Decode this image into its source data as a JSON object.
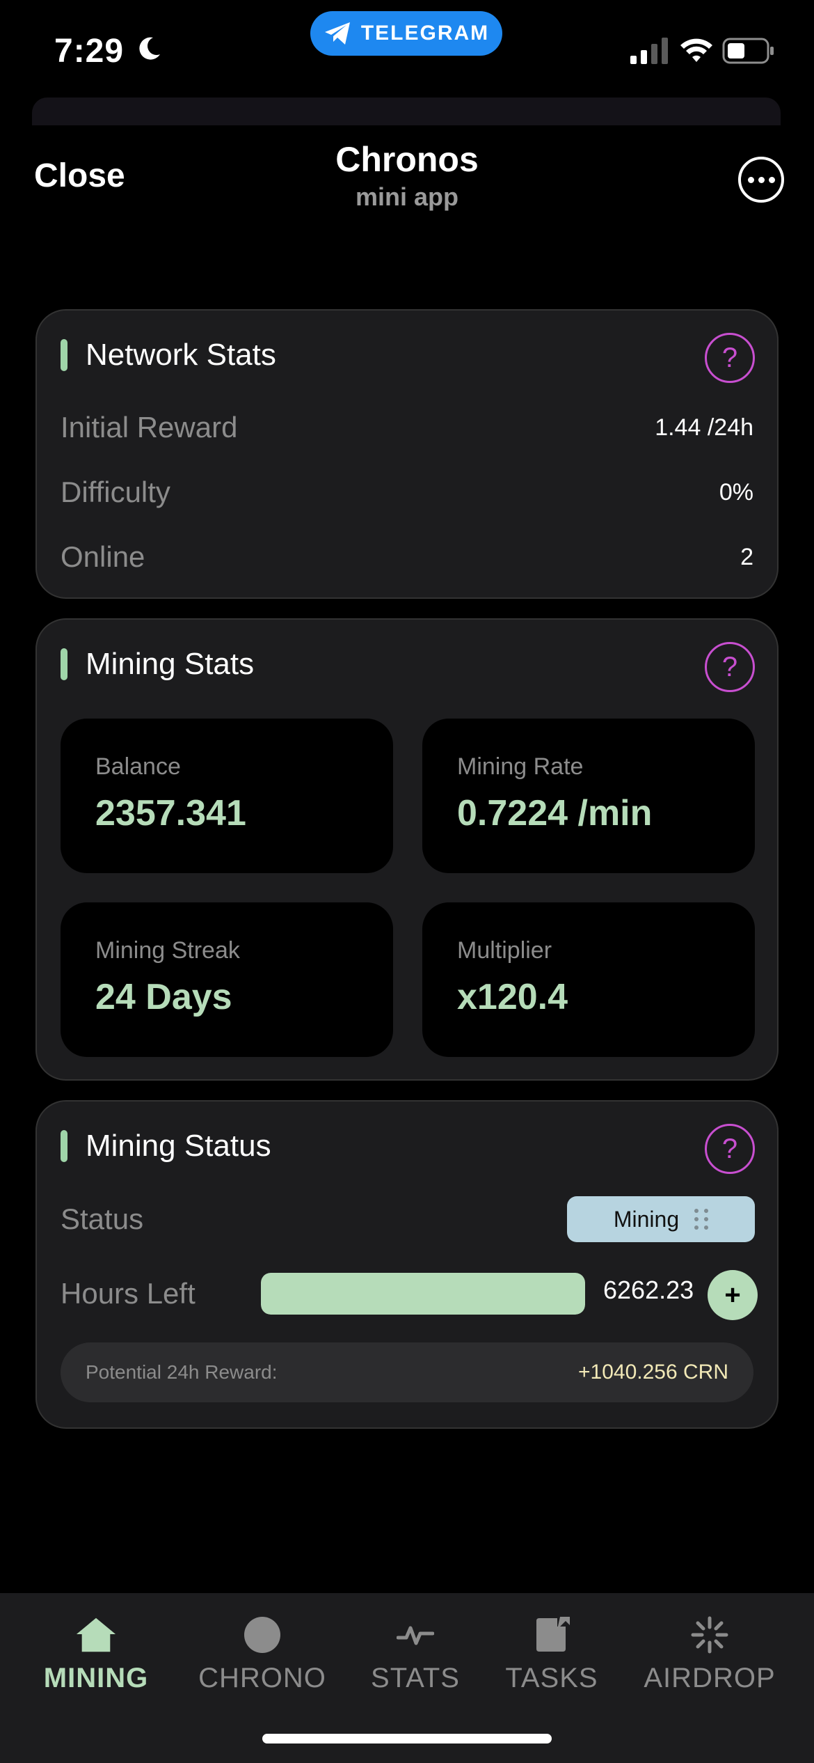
{
  "status_bar": {
    "time": "7:29",
    "telegram_label": "TELEGRAM"
  },
  "header": {
    "close_label": "Close",
    "title": "Chronos",
    "subtitle": "mini app"
  },
  "help_label": "?",
  "network_stats": {
    "title": "Network Stats",
    "rows": [
      {
        "label": "Initial Reward",
        "value": "1.44 /24h"
      },
      {
        "label": "Difficulty",
        "value": "0%"
      },
      {
        "label": "Online",
        "value": "2"
      }
    ]
  },
  "mining_stats": {
    "title": "Mining Stats",
    "tiles": [
      {
        "label": "Balance",
        "value": "2357.341"
      },
      {
        "label": "Mining Rate",
        "value": "0.7224 /min"
      },
      {
        "label": "Mining Streak",
        "value": "24 Days"
      },
      {
        "label": "Multiplier",
        "value": "x120.4"
      }
    ]
  },
  "mining_status": {
    "title": "Mining Status",
    "status_label": "Status",
    "status_value": "Mining",
    "hours_label": "Hours Left",
    "hours_value": "6262.23",
    "hours_progress": 1.0,
    "plus_label": "+",
    "reward_label": "Potential 24h Reward:",
    "reward_value": "+1040.256 CRN"
  },
  "nav": {
    "items": [
      {
        "label": "MINING",
        "icon": "home-icon",
        "active": true
      },
      {
        "label": "CHRONO",
        "icon": "circle-icon",
        "active": false
      },
      {
        "label": "STATS",
        "icon": "pulse-icon",
        "active": false
      },
      {
        "label": "TASKS",
        "icon": "task-icon",
        "active": false
      },
      {
        "label": "AIRDROP",
        "icon": "sparkle-icon",
        "active": false
      }
    ]
  },
  "colors": {
    "accent_green": "#b6dcb9",
    "help_purple": "#c84fd0",
    "status_chip": "#b7d4e0",
    "reward_yellow": "#f2e9b7",
    "telegram_blue": "#1e88f0"
  }
}
